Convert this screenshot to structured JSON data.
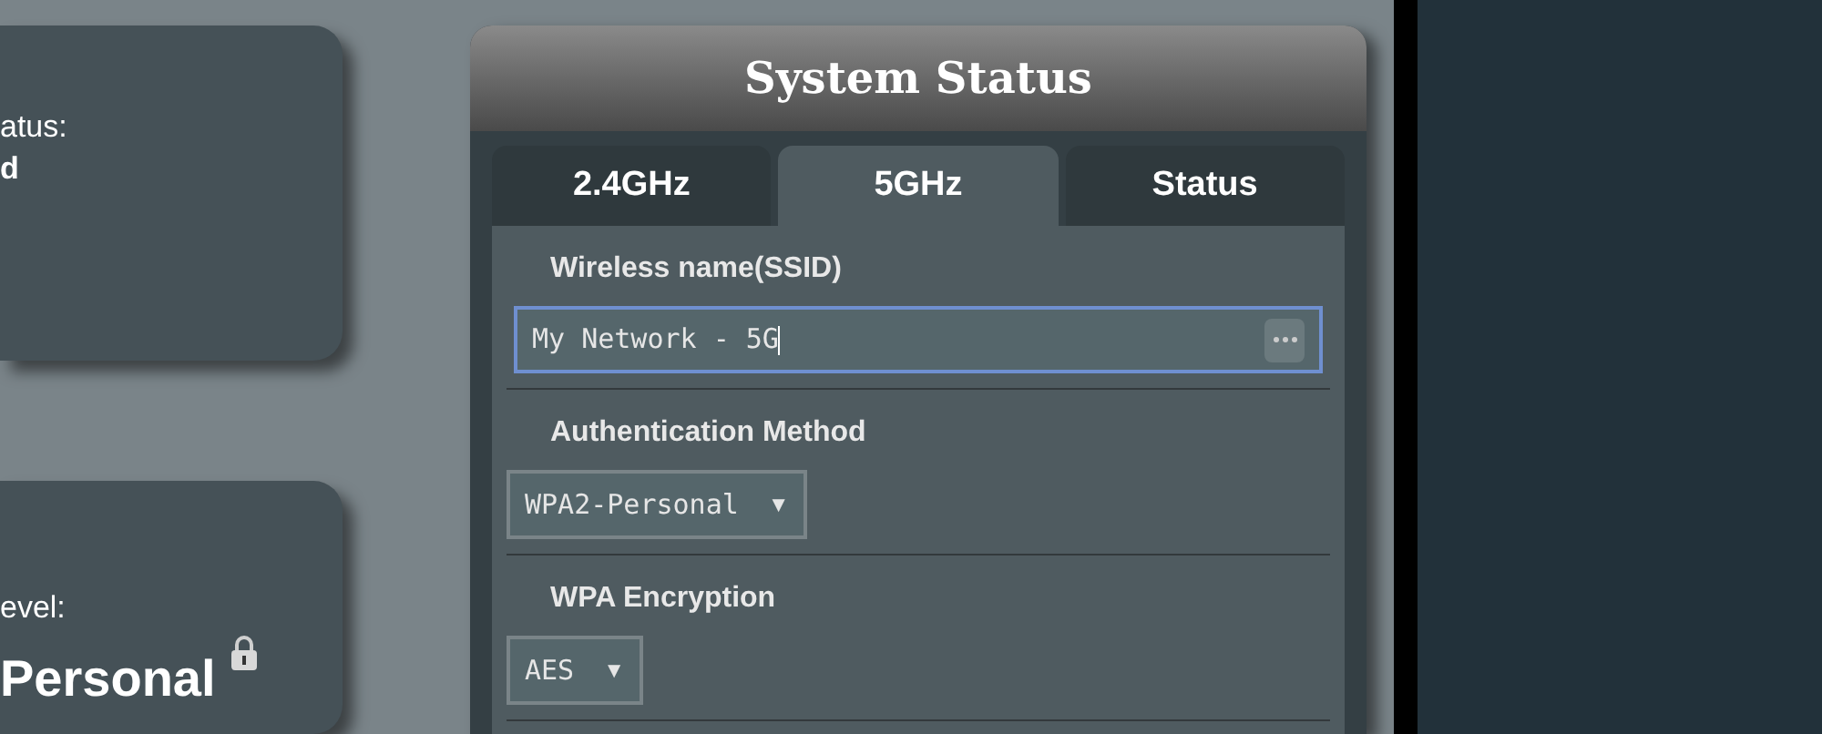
{
  "left_cards": [
    {
      "lines": [
        "atus:",
        "d"
      ]
    },
    {
      "lines": [
        "evel:",
        "Personal"
      ],
      "locked": true
    }
  ],
  "panel": {
    "title": "System Status",
    "tabs": [
      {
        "label": "2.4GHz",
        "selected": false
      },
      {
        "label": "5GHz",
        "selected": true
      },
      {
        "label": "Status",
        "selected": false
      }
    ],
    "fields": [
      {
        "kind": "text",
        "label": "Wireless name(SSID)",
        "value": "My Network - 5G",
        "focused": true
      },
      {
        "kind": "select",
        "label": "Authentication Method",
        "value": "WPA2-Personal",
        "arrow": "▼"
      },
      {
        "kind": "select",
        "label": "WPA Encryption",
        "value": "AES",
        "arrow": "▼"
      }
    ]
  }
}
